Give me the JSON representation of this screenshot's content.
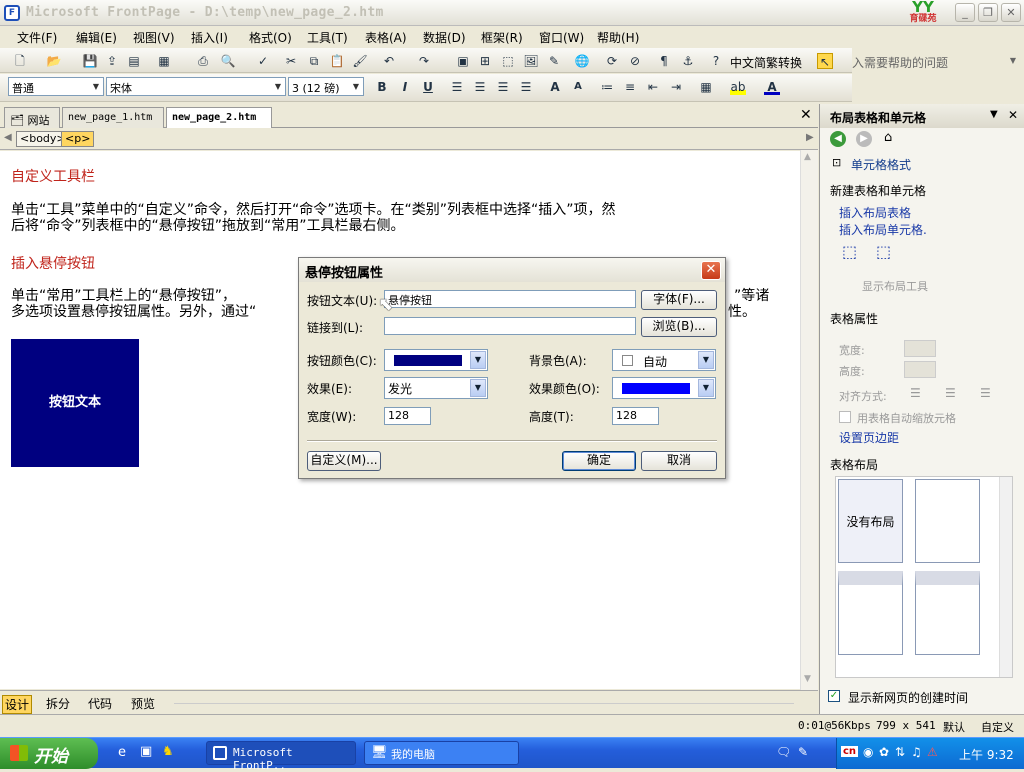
{
  "window": {
    "title": "Microsoft FrontPage - D:\\temp\\new_page_2.htm",
    "minimize": "_",
    "restore": "❐",
    "close": "✕"
  },
  "logo": {
    "text": "YY",
    "sub": "育碟苑"
  },
  "menus": [
    "文件(F)",
    "编辑(E)",
    "视图(V)",
    "插入(I)",
    "格式(O)",
    "工具(T)",
    "表格(A)",
    "数据(D)",
    "框架(R)",
    "窗口(W)",
    "帮助(H)"
  ],
  "help_box": "键入需要帮助的问题",
  "toolbar": {
    "convert_label": "中文简繁转换"
  },
  "format_bar": {
    "style": "普通",
    "font": "宋体",
    "size": "3 (12 磅)"
  },
  "doc_tabs": {
    "site": "网站",
    "tab1": "new_page_1.htm",
    "tab2": "new_page_2.htm"
  },
  "tags": {
    "body": "<body>",
    "p": "<p>"
  },
  "document": {
    "heading1": "自定义工具栏",
    "para1_line1": "单击“工具”菜单中的“自定义”命令，然后打开“命令”选项卡。在“类别”列表框中选择“插入”项，然",
    "para1_line2": "后将“命令”列表框中的“悬停按钮”拖放到“常用”工具栏最右侧。",
    "heading2": "插入悬停按钮",
    "para2_line1a": "单击“常用”工具栏上的“悬停按钮”，",
    "para2_line1b": "”等诸",
    "para2_line2a": "多选项设置悬停按钮属性。另外，通过“",
    "para2_line2b": "性。",
    "hover_button_text": "按钮文本"
  },
  "view_tabs": {
    "design": "设计",
    "split": "拆分",
    "code": "代码",
    "preview": "预览"
  },
  "status": {
    "speed": "0:01@56Kbps",
    "size": "799 x 541",
    "mode": "默认",
    "custom": "自定义"
  },
  "task_pane": {
    "title": "布局表格和单元格",
    "cell_format": "单元格格式",
    "section_new": "新建表格和单元格",
    "insert_table": "插入布局表格",
    "insert_cell": "插入布局单元格.",
    "show_tools": "显示布局工具",
    "section_props": "表格属性",
    "width_label": "宽度:",
    "height_label": "高度:",
    "align_label": "对齐方式:",
    "autoscale": "用表格自动缩放元格",
    "margins_link": "设置页边距",
    "section_layout": "表格布局",
    "no_layout": "没有布局",
    "show_on_create": "显示新网页的创建时间"
  },
  "dialog": {
    "title": "悬停按钮属性",
    "button_text_label": "按钮文本(U):",
    "button_text_value": "悬停按钮",
    "font_button": "字体(F)...",
    "link_label": "链接到(L):",
    "link_value": "",
    "browse_button": "浏览(B)...",
    "button_color_label": "按钮颜色(C):",
    "background_color_label": "背景色(A):",
    "background_value": "自动",
    "effect_label": "效果(E):",
    "effect_value": "发光",
    "effect_color_label": "效果颜色(O):",
    "width_label": "宽度(W):",
    "width_value": "128",
    "height_label": "高度(T):",
    "height_value": "128",
    "custom_button": "自定义(M)...",
    "ok_button": "确定",
    "cancel_button": "取消",
    "colors": {
      "button_color": "#000080",
      "effect_color": "#0000ff"
    }
  },
  "taskbar": {
    "start": "开始",
    "task1": "Microsoft FrontP..",
    "task2": "我的电脑",
    "ime": "cn",
    "clock": "上午 9:32"
  }
}
